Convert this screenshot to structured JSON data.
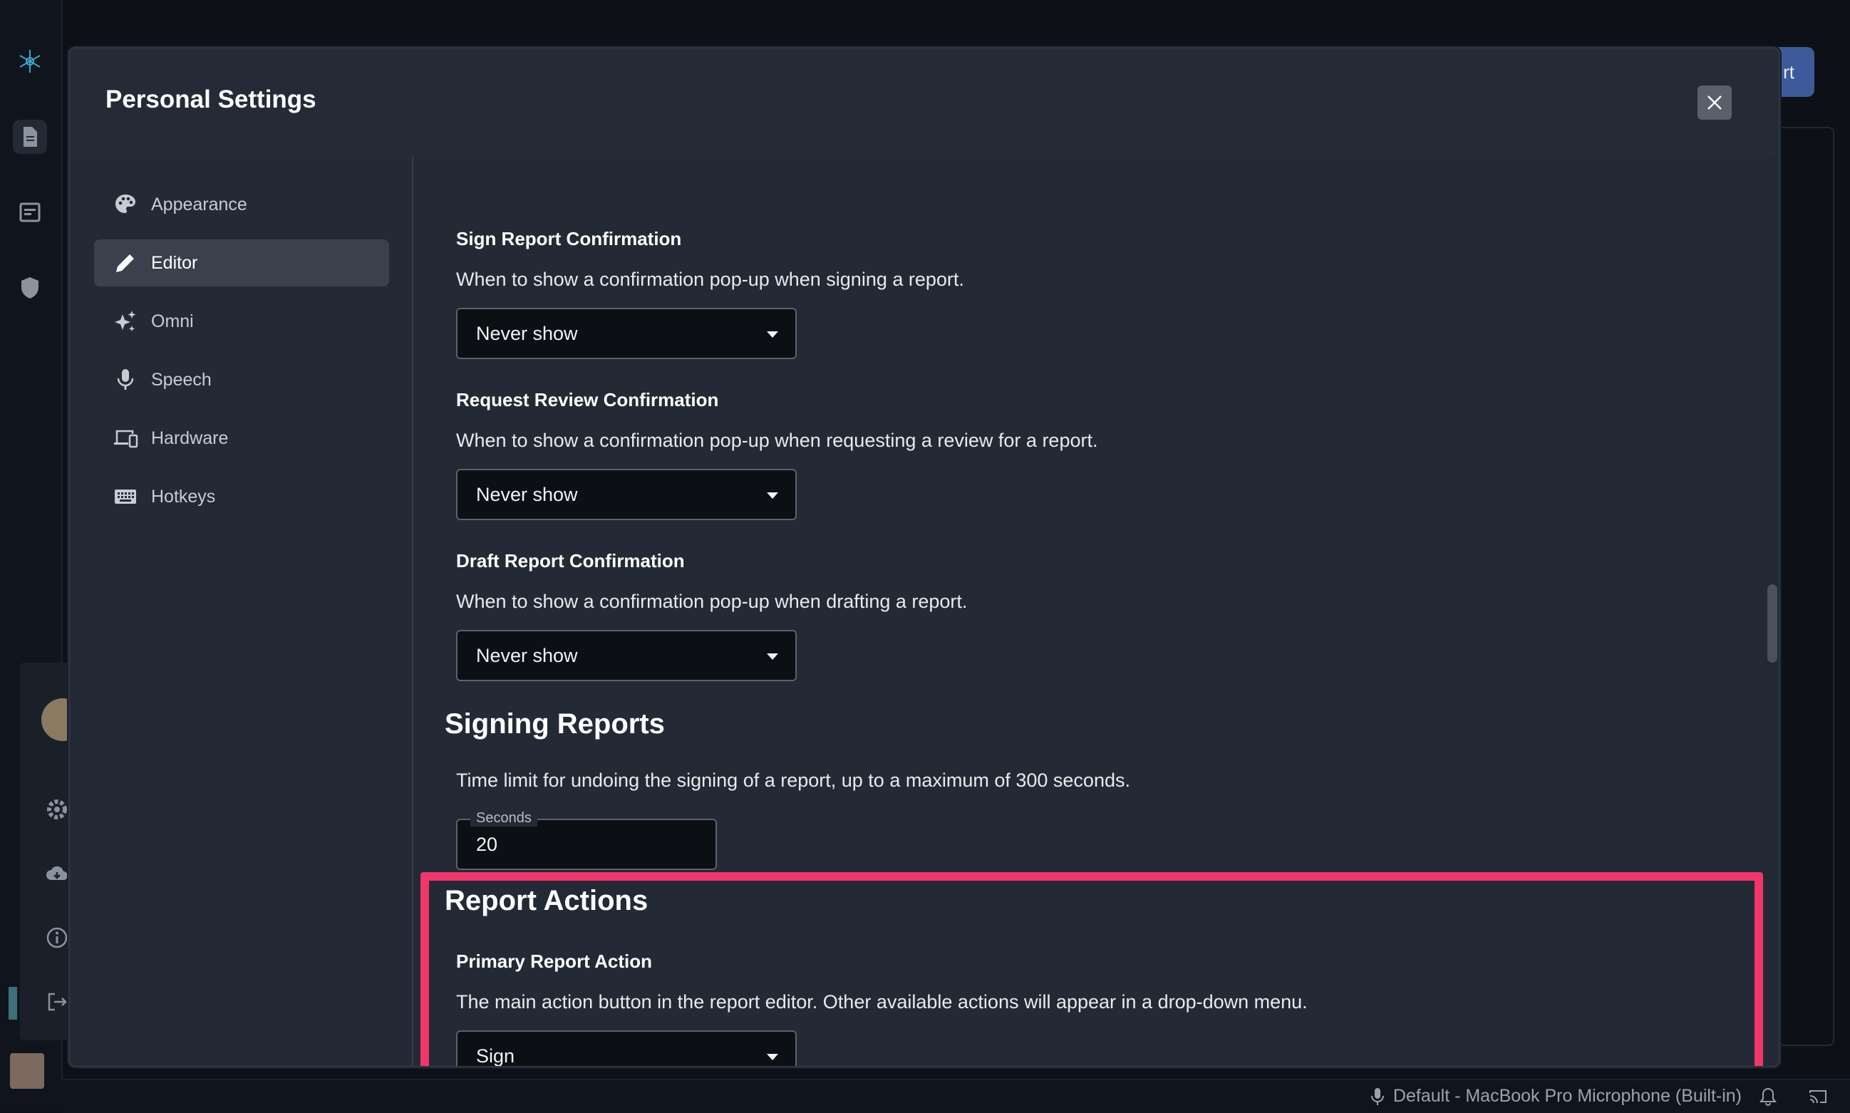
{
  "modal": {
    "title": "Personal Settings"
  },
  "background": {
    "button_fragment": "rt"
  },
  "nav": [
    {
      "label": "Appearance",
      "icon": "palette-icon"
    },
    {
      "label": "Editor",
      "icon": "pencil-icon",
      "active": true
    },
    {
      "label": "Omni",
      "icon": "sparkles-icon"
    },
    {
      "label": "Speech",
      "icon": "microphone-icon"
    },
    {
      "label": "Hardware",
      "icon": "devices-icon"
    },
    {
      "label": "Hotkeys",
      "icon": "keyboard-icon"
    }
  ],
  "settings": {
    "sign_confirm": {
      "title": "Sign Report Confirmation",
      "desc": "When to show a confirmation pop-up when signing a report.",
      "value": "Never show"
    },
    "review_confirm": {
      "title": "Request Review Confirmation",
      "desc": "When to show a confirmation pop-up when requesting a review for a report.",
      "value": "Never show"
    },
    "draft_confirm": {
      "title": "Draft Report Confirmation",
      "desc": "When to show a confirmation pop-up when drafting a report.",
      "value": "Never show"
    },
    "signing": {
      "section": "Signing Reports",
      "desc": "Time limit for undoing the signing of a report, up to a maximum of 300 seconds.",
      "field_label": "Seconds",
      "value": "20"
    },
    "actions": {
      "section": "Report Actions",
      "title": "Primary Report Action",
      "desc": "The main action button in the report editor. Other available actions will appear in a drop-down menu.",
      "value": "Sign"
    }
  },
  "status": {
    "microphone": "Default - MacBook Pro Microphone (Built-in)"
  },
  "colors": {
    "highlight": "#f0366b",
    "modal_bg": "#242a35",
    "active_nav": "#3a414d"
  }
}
